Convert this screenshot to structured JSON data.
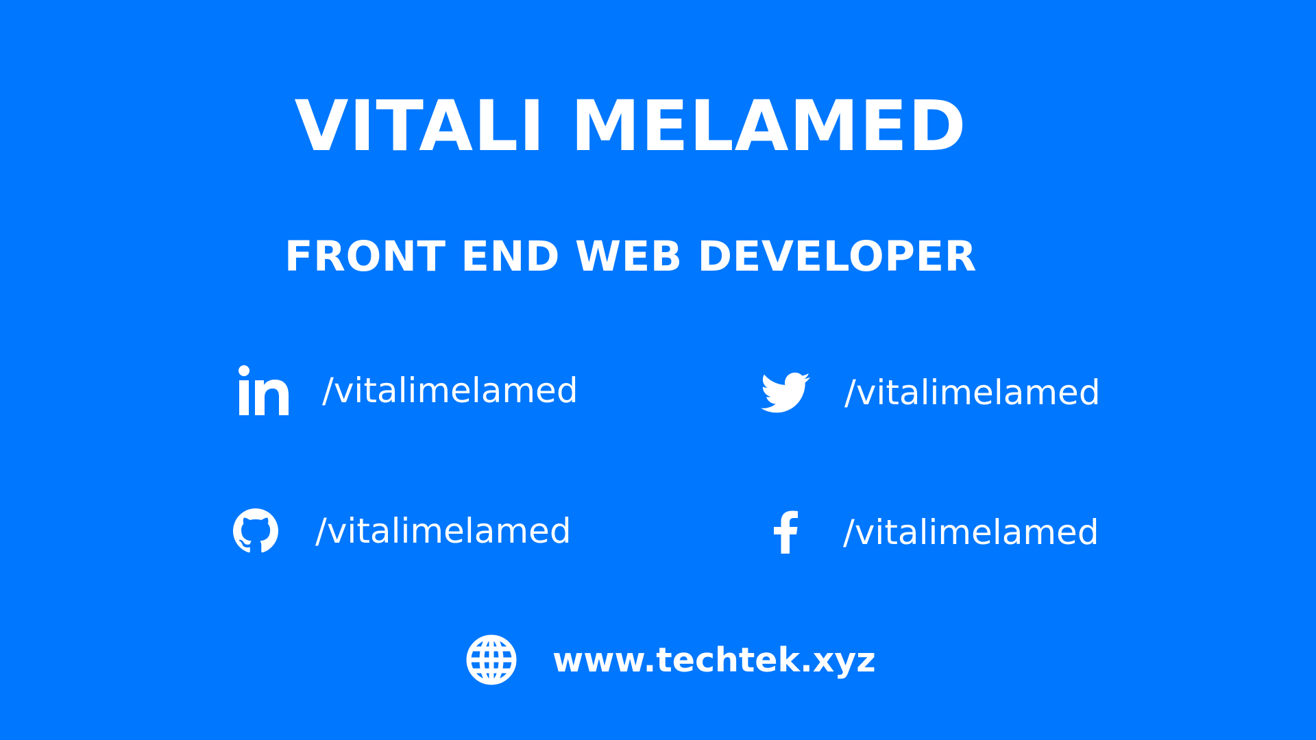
{
  "name": "VITALI MELAMED",
  "role": "FRONT END WEB DEVELOPER",
  "background_color": "#0077FF",
  "text_color": "#FFFFFF",
  "links": {
    "linkedin": {
      "icon": "linkedin-icon",
      "handle": "/vitalimelamed"
    },
    "twitter": {
      "icon": "twitter-icon",
      "handle": "/vitalimelamed"
    },
    "github": {
      "icon": "github-icon",
      "handle": "/vitalimelamed"
    },
    "facebook": {
      "icon": "facebook-icon",
      "handle": "/vitalimelamed"
    },
    "website": {
      "icon": "globe-icon",
      "handle": "www.techtek.xyz"
    }
  }
}
